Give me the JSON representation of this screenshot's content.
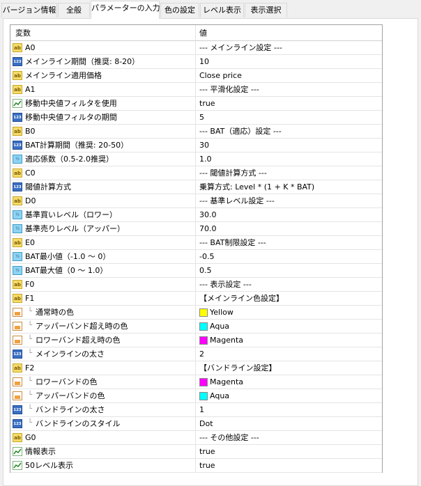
{
  "tabs": [
    {
      "label": "バージョン情報",
      "active": false
    },
    {
      "label": "全般",
      "active": false
    },
    {
      "label": "パラメーターの入力",
      "active": true
    },
    {
      "label": "色の設定",
      "active": false
    },
    {
      "label": "レベル表示",
      "active": false
    },
    {
      "label": "表示選択",
      "active": false
    }
  ],
  "table": {
    "headers": {
      "name": "変数",
      "value": "値"
    },
    "rows": [
      {
        "icon": "string-icon",
        "name": "A0",
        "value": "--- メインライン設定 ---"
      },
      {
        "icon": "integer-icon",
        "name": "メインライン期間（推奨: 8-20）",
        "value": "10"
      },
      {
        "icon": "string-icon",
        "name": "メインライン適用価格",
        "value": "Close price"
      },
      {
        "icon": "string-icon",
        "name": "A1",
        "value": "--- 平滑化設定 ---"
      },
      {
        "icon": "bool-icon",
        "name": "移動中央値フィルタを使用",
        "value": "true"
      },
      {
        "icon": "integer-icon",
        "name": "移動中央値フィルタの期間",
        "value": "5"
      },
      {
        "icon": "string-icon",
        "name": "B0",
        "value": "--- BAT（適応）設定 ---"
      },
      {
        "icon": "integer-icon",
        "name": "BAT計算期間（推奨: 20-50）",
        "value": "30"
      },
      {
        "icon": "double-icon",
        "name": "適応係数（0.5-2.0推奨）",
        "value": "1.0"
      },
      {
        "icon": "string-icon",
        "name": "C0",
        "value": "--- 閾値計算方式 ---"
      },
      {
        "icon": "integer-icon",
        "name": "閾値計算方式",
        "value": "乗算方式: Level * (1 + K * BAT)"
      },
      {
        "icon": "string-icon",
        "name": "D0",
        "value": "--- 基準レベル設定 ---"
      },
      {
        "icon": "double-icon",
        "name": "基準買いレベル（ロワー）",
        "value": "30.0"
      },
      {
        "icon": "double-icon",
        "name": "基準売りレベル（アッパー）",
        "value": "70.0"
      },
      {
        "icon": "string-icon",
        "name": "E0",
        "value": "--- BAT制限設定 ---"
      },
      {
        "icon": "double-icon",
        "name": "BAT最小値（-1.0 〜 0）",
        "value": "-0.5"
      },
      {
        "icon": "double-icon",
        "name": "BAT最大値（0 〜 1.0）",
        "value": "0.5"
      },
      {
        "icon": "string-icon",
        "name": "F0",
        "value": "--- 表示設定 ---"
      },
      {
        "icon": "string-icon",
        "name": "F1",
        "value": "【メインライン色設定】"
      },
      {
        "icon": "color-icon",
        "tree": true,
        "name": "通常時の色",
        "value": "Yellow",
        "swatch": "#ffff00"
      },
      {
        "icon": "color-icon",
        "tree": true,
        "name": "アッパーバンド超え時の色",
        "value": "Aqua",
        "swatch": "#00ffff"
      },
      {
        "icon": "color-icon",
        "tree": true,
        "name": "ロワーバンド超え時の色",
        "value": "Magenta",
        "swatch": "#ff00ff"
      },
      {
        "icon": "integer-icon",
        "tree": true,
        "name": "メインラインの太さ",
        "value": "2"
      },
      {
        "icon": "string-icon",
        "name": "F2",
        "value": "【バンドライン設定】"
      },
      {
        "icon": "color-icon",
        "tree": true,
        "name": "ロワーバンドの色",
        "value": "Magenta",
        "swatch": "#ff00ff"
      },
      {
        "icon": "color-icon",
        "tree": true,
        "name": "アッパーバンドの色",
        "value": "Aqua",
        "swatch": "#00ffff"
      },
      {
        "icon": "integer-icon",
        "tree": true,
        "name": "バンドラインの太さ",
        "value": "1"
      },
      {
        "icon": "integer-icon",
        "tree": true,
        "name": "バンドラインのスタイル",
        "value": "Dot"
      },
      {
        "icon": "string-icon",
        "name": "G0",
        "value": "--- その他設定 ---"
      },
      {
        "icon": "bool-icon",
        "name": "情報表示",
        "value": "true"
      },
      {
        "icon": "bool-icon",
        "name": "50レベル表示",
        "value": "true"
      }
    ]
  },
  "tree_glyph": "└"
}
